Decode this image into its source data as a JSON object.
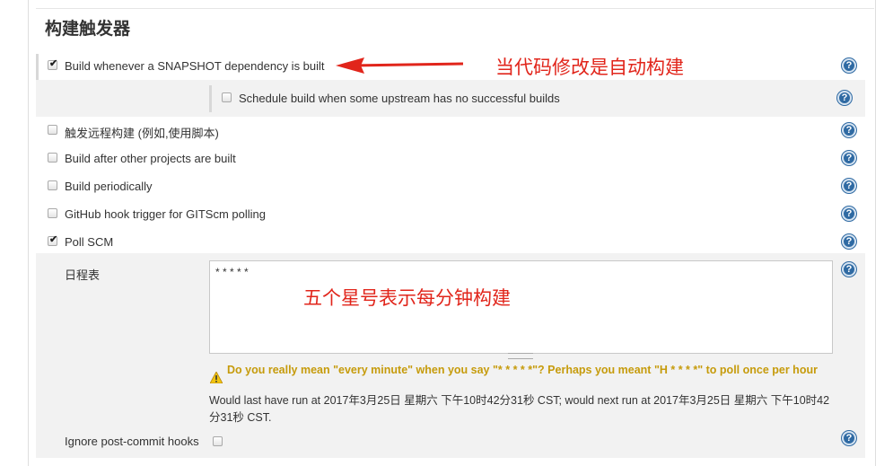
{
  "section": {
    "title": "构建触发器"
  },
  "triggers": {
    "snapshot": {
      "label": "Build whenever a SNAPSHOT dependency is built",
      "checked": true
    },
    "upstream": {
      "label": "Schedule build when some upstream has no successful builds",
      "checked": false
    },
    "remote": {
      "label": "触发远程构建 (例如,使用脚本)",
      "checked": false
    },
    "after_other": {
      "label": "Build after other projects are built",
      "checked": false
    },
    "periodic": {
      "label": "Build periodically",
      "checked": false
    },
    "github": {
      "label": "GitHub hook trigger for GITScm polling",
      "checked": false
    },
    "poll_scm": {
      "label": "Poll SCM",
      "checked": true
    },
    "ignore_hooks": {
      "label": "Ignore post-commit hooks",
      "checked": false
    }
  },
  "schedule": {
    "label": "日程表",
    "value": "* * * * *",
    "warning": "Do you really mean \"every minute\" when you say \"* * * * *\"? Perhaps you meant \"H * * * *\" to poll once per hour",
    "info": "Would last have run at 2017年3月25日 星期六 下午10时42分31秒 CST; would next run at 2017年3月25日 星期六 下午10时42分31秒 CST."
  },
  "annotations": {
    "arrow_note": "当代码修改是自动构建",
    "schedule_note": "五个星号表示每分钟构建"
  },
  "help_glyph": "?",
  "colors": {
    "help": "#2f6aa3",
    "warning": "#c69b0b",
    "annotation": "#e1251b",
    "shade": "#f2f2f2"
  }
}
